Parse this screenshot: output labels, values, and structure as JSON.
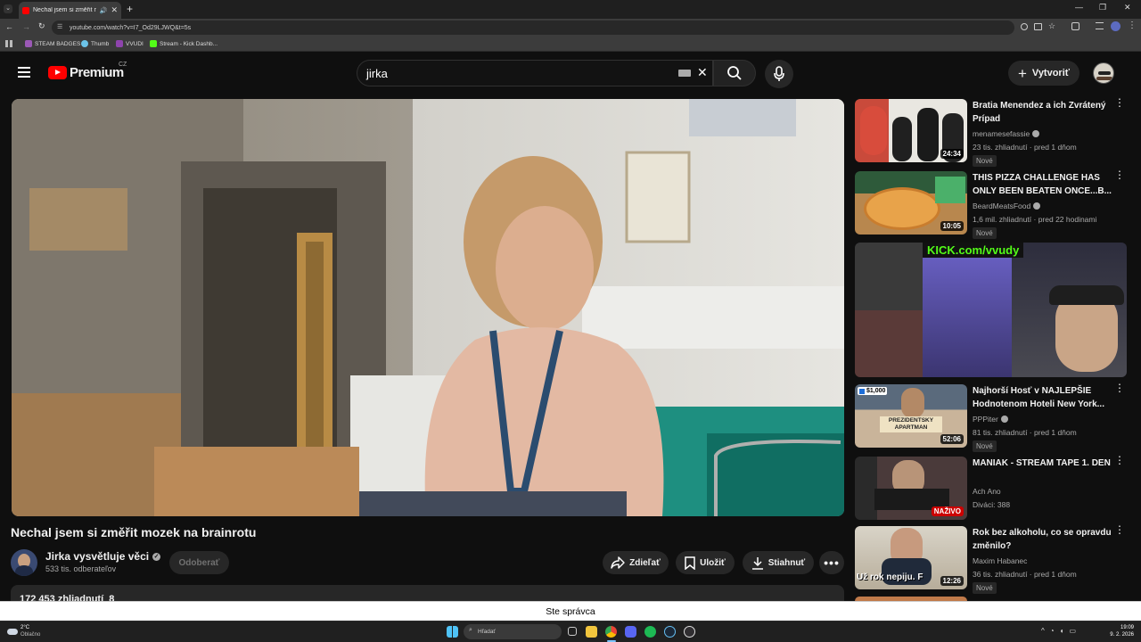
{
  "browser": {
    "tab_title": "Nechal jsem si změřit mozek na brainrotu",
    "url": "youtube.com/watch?v=I7_Od29LJWQ&t=5s",
    "bookmarks": [
      "STEAM BADGES",
      "Thumb",
      "VVUDI",
      "Stream - Kick Dashb..."
    ]
  },
  "header": {
    "logo_text": "Premium",
    "region": "CZ",
    "search_value": "jirka",
    "create_label": "Vytvoriť"
  },
  "video": {
    "title": "Nechal jsem si změřit mozek na brainrotu",
    "channel": "Jirka vysvětluje věci",
    "subscribers": "533 tis. odberateľov",
    "subscribe_label": "Odoberať",
    "share_label": "Zdieľať",
    "save_label": "Uložiť",
    "download_label": "Stiahnuť",
    "views_line": "172 453 zhliadnutí  8"
  },
  "recommendations": [
    {
      "title": "Bratia Menendez a ich Zvrátený Prípad",
      "channel": "menamesefassie",
      "meta": "23 tis. zhliadnutí · pred 1 dňom",
      "duration": "24:34",
      "badge": "Nové"
    },
    {
      "title": "THIS PIZZA CHALLENGE HAS ONLY BEEN BEATEN ONCE...B...",
      "channel": "BeardMeatsFood",
      "meta": "1,6 mil. zhliadnutí · pred 22 hodinami",
      "duration": "10:05",
      "badge": "Nové"
    },
    {
      "ad_text": "KICK.com/vvudy"
    },
    {
      "title": "Najhorší Hosť v NAJLEPŠIE Hodnotenom Hoteli New York...",
      "channel": "PPPiter",
      "meta": "81 tis. zhliadnutí · pred 1 dňom",
      "duration": "52:06",
      "badge": "Nové",
      "price": "$1,000",
      "thumb_text": "PREZIDENTSKY APARTMAN"
    },
    {
      "title": "MANIAK - STREAM TAPE 1. DEN",
      "channel": "Ach Ano",
      "meta": "Diváci: 388",
      "live": "NAŽIVO"
    },
    {
      "title": "Rok bez alkoholu, co se opravdu změnilo?",
      "channel": "Maxim Habanec",
      "meta": "36 tis. zhliadnutí · pred 1 dňom",
      "duration": "12:26",
      "badge": "Nové",
      "thumb_text": "Už rok nepiju. F"
    }
  ],
  "banner_text": "Ste správca",
  "taskbar": {
    "weather_temp": "2°C",
    "weather_desc": "Oblačno",
    "search_placeholder": "Hľadať",
    "time": "19:09",
    "date": "9. 2. 2026"
  }
}
